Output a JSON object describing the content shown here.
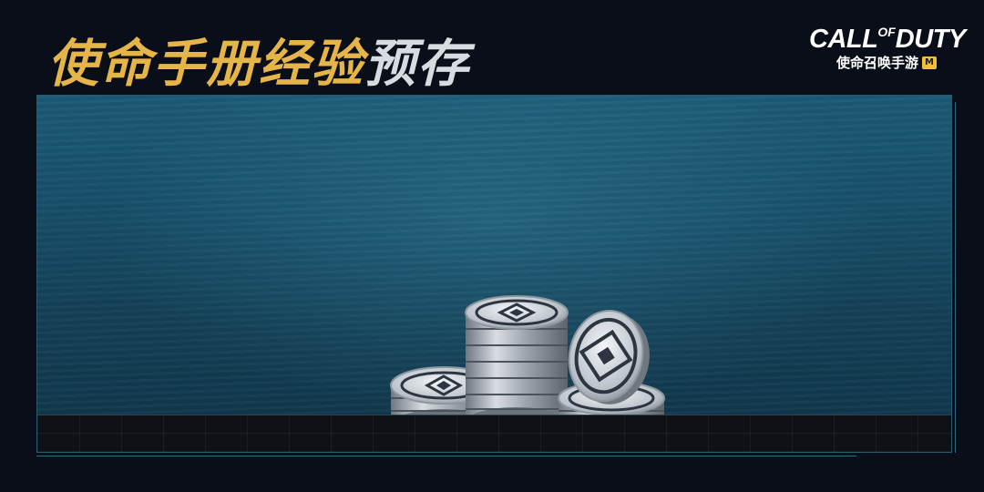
{
  "header": {
    "title_highlight": "使命手册经验",
    "title_rest": "预存"
  },
  "logo": {
    "main_left": "CALL",
    "main_of": "OF",
    "main_right": "DUTY",
    "sub": "使命召唤手游",
    "badge": "M"
  },
  "colors": {
    "title_gold": "#e6b54a",
    "title_silver": "#d8dbe0",
    "panel": "#174d66",
    "background": "#0a0e18"
  },
  "icons": [
    "silver-coin-stack-icon"
  ]
}
